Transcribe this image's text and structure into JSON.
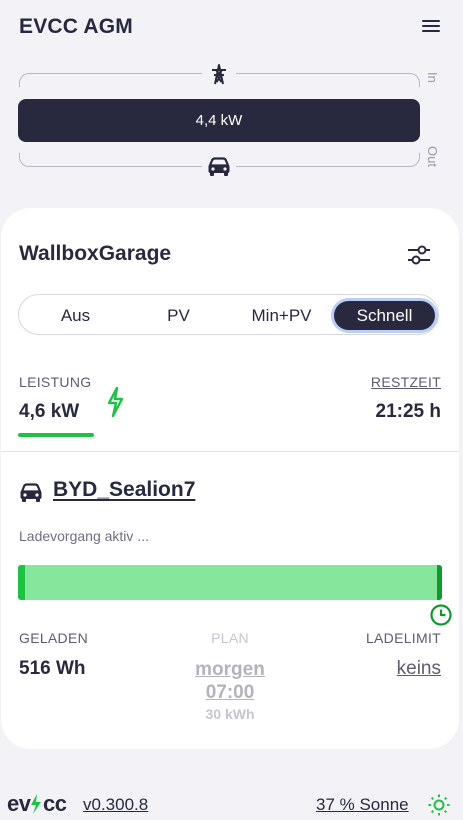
{
  "header": {
    "title": "EVCC AGM"
  },
  "energyflow": {
    "in_label": "In",
    "out_label": "Out",
    "bar_value": "4,4 kW"
  },
  "loadpoint": {
    "title": "WallboxGarage",
    "modes": [
      {
        "label": "Aus",
        "active": false
      },
      {
        "label": "PV",
        "active": false
      },
      {
        "label": "Min+PV",
        "active": false
      },
      {
        "label": "Schnell",
        "active": true
      }
    ],
    "power_label": "LEISTUNG",
    "power_value": "4,6 kW",
    "remaining_label": "RESTZEIT",
    "remaining_value": "21:25 h",
    "vehicle_name": "BYD_Sealion7",
    "status": "Ladevorgang aktiv ...",
    "charged_label": "GELADEN",
    "charged_value": "516 Wh",
    "plan_label": "PLAN",
    "plan_day": "morgen",
    "plan_time": "07:00",
    "plan_energy": "30 kWh",
    "limit_label": "LADELIMIT",
    "limit_value": "keins"
  },
  "footer": {
    "logo": "evcc",
    "version": "v0.300.8",
    "sun": "37 % Sonne"
  },
  "colors": {
    "dark": "#28293e",
    "green": "#1fc145",
    "light_green": "#86e69c",
    "background": "#f3f3f7"
  },
  "icons": [
    "menu-icon",
    "power-tower-icon",
    "car-icon",
    "sliders-icon",
    "lightning-icon",
    "clock-icon",
    "sun-icon"
  ]
}
